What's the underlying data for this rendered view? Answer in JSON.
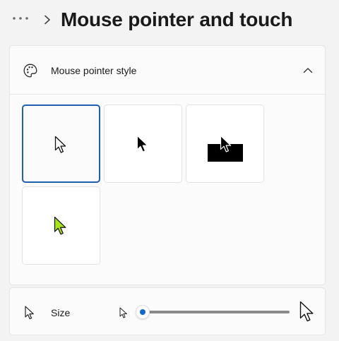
{
  "header": {
    "more_icon": "more-horizontal-icon",
    "separator_icon": "chevron-right-icon",
    "title": "Mouse pointer and touch"
  },
  "pointer_style": {
    "icon": "palette-icon",
    "label": "Mouse pointer style",
    "expanded": true,
    "chevron_icon": "chevron-up-icon",
    "options": [
      {
        "id": "white",
        "icon": "white-pointer-icon",
        "selected": true
      },
      {
        "id": "black",
        "icon": "black-pointer-icon",
        "selected": false
      },
      {
        "id": "inverted",
        "icon": "inverted-pointer-icon",
        "selected": false
      },
      {
        "id": "custom",
        "icon": "custom-color-pointer-icon",
        "color": "#a8e41b",
        "selected": false
      }
    ]
  },
  "size": {
    "icon": "pointer-size-icon",
    "label": "Size",
    "value": 1,
    "min": 1,
    "max": 15
  },
  "colors": {
    "accent": "#0f67c8",
    "selection_border": "#1e5fb0",
    "custom_pointer": "#a8e41b"
  }
}
